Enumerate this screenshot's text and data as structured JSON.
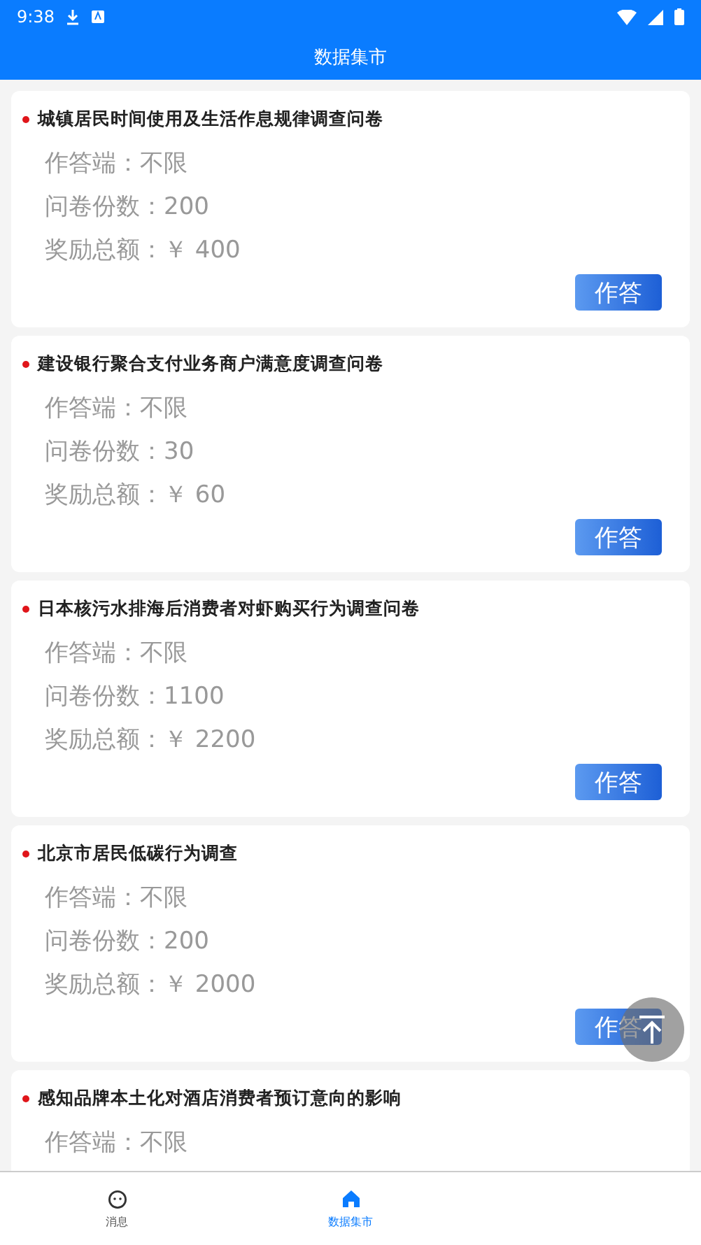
{
  "status_bar": {
    "time": "9:38"
  },
  "header": {
    "title": "数据集市"
  },
  "surveys": [
    {
      "title": "城镇居民时间使用及生活作息规律调查问卷",
      "platform": "作答端：不限",
      "copies": "问卷份数：200",
      "reward": "奖励总额：￥ 400",
      "action": "作答"
    },
    {
      "title": "建设银行聚合支付业务商户满意度调查问卷",
      "platform": "作答端：不限",
      "copies": "问卷份数：30",
      "reward": "奖励总额：￥ 60",
      "action": "作答"
    },
    {
      "title": "日本核污水排海后消费者对虾购买行为调查问卷",
      "platform": "作答端：不限",
      "copies": "问卷份数：1100",
      "reward": "奖励总额：￥ 2200",
      "action": "作答"
    },
    {
      "title": "北京市居民低碳行为调查",
      "platform": "作答端：不限",
      "copies": "问卷份数：200",
      "reward": "奖励总额：￥ 2000",
      "action": "作答"
    },
    {
      "title": "感知品牌本土化对酒店消费者预订意向的影响",
      "platform": "作答端：不限"
    }
  ],
  "bottom_nav": [
    {
      "label": "消息",
      "kind": "face",
      "selected": false
    },
    {
      "label": "数据集市",
      "kind": "home",
      "selected": true
    }
  ]
}
